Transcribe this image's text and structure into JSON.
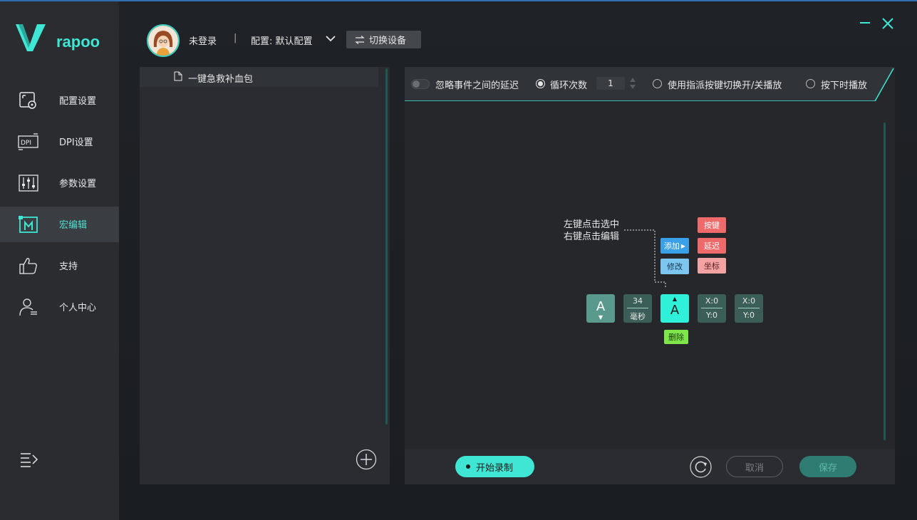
{
  "brand": {
    "name": "rapoo",
    "accent": "#3fe6d3"
  },
  "window": {
    "minimize_icon": "minimize-icon",
    "close_icon": "close-icon"
  },
  "header": {
    "user_name": "未登录",
    "separator": "|",
    "config_label": "配置: 默认配置",
    "switch_device_label": "切换设备"
  },
  "sidebar": {
    "items": [
      {
        "label": "配置设置",
        "icon": "config-icon",
        "active": false
      },
      {
        "label": "DPI设置",
        "icon": "dpi-icon",
        "active": false
      },
      {
        "label": "参数设置",
        "icon": "sliders-icon",
        "active": false
      },
      {
        "label": "宏编辑",
        "icon": "macro-icon",
        "active": true
      },
      {
        "label": "支持",
        "icon": "thumbs-up-icon",
        "active": false
      },
      {
        "label": "个人中心",
        "icon": "user-icon",
        "active": false
      }
    ],
    "dpi_icon_text": "DPI"
  },
  "macro_list": {
    "items": [
      {
        "label": "一键急救补血包"
      }
    ]
  },
  "toolbar": {
    "ignore_delay_label": "忽略事件之间的延迟",
    "loop_count_label": "循环次数",
    "loop_count_value": "1",
    "assign_toggle_label": "使用指派按键切换开/关播放",
    "press_play_label": "按下时播放",
    "selected_mode": "loop_count"
  },
  "canvas": {
    "hint_line1": "左键点击选中",
    "hint_line2": "右键点击编辑",
    "menu": {
      "add": "添加",
      "modify": "修改",
      "key": "按键",
      "delay": "延迟",
      "coord": "坐标",
      "delete": "删除"
    },
    "nodes": [
      {
        "type": "key-down",
        "label": "A",
        "arrow": "▼"
      },
      {
        "type": "delay",
        "value": "34",
        "unit": "毫秒"
      },
      {
        "type": "key-up",
        "label": "A",
        "arrow": "▲"
      },
      {
        "type": "coord",
        "x": "X:0",
        "y": "Y:0"
      },
      {
        "type": "coord",
        "x": "X:0",
        "y": "Y:0"
      }
    ]
  },
  "bottombar": {
    "record_label": "开始录制",
    "cancel_label": "取消",
    "save_label": "保存"
  }
}
